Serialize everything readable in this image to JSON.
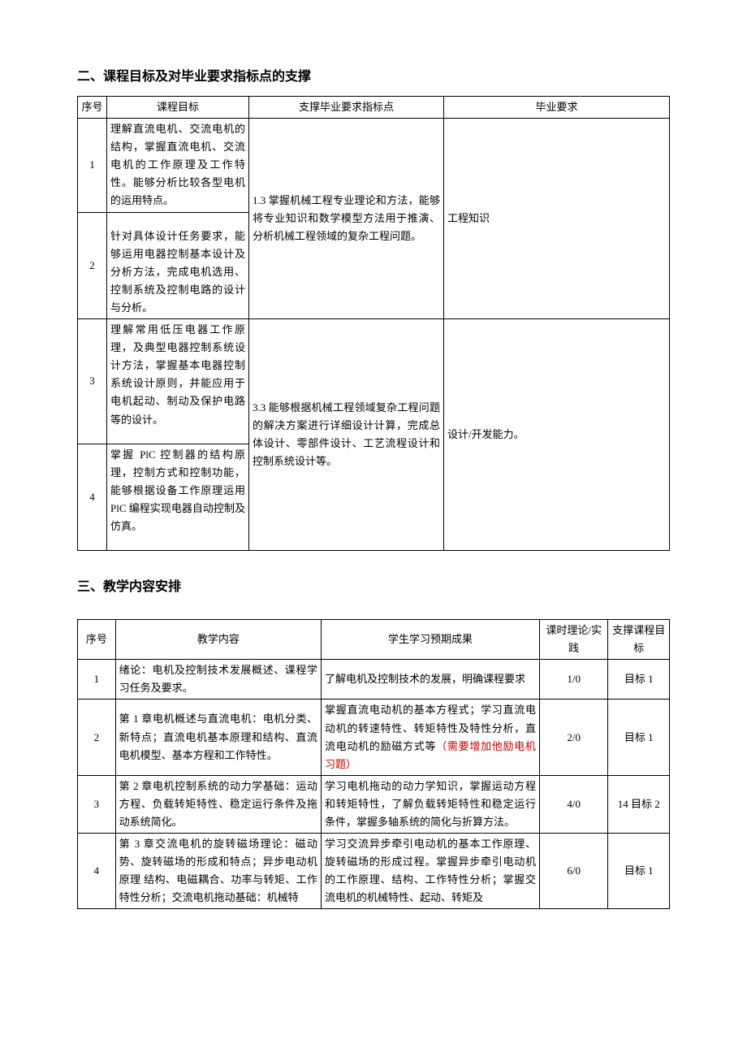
{
  "section2": {
    "title": "二、课程目标及对毕业要求指标点的支撑",
    "headers": [
      "序号",
      "课程目标",
      "支撑毕业要求指标点",
      "毕业要求"
    ],
    "rows": [
      {
        "num": "1",
        "goal": "理解直流电机、交流电机的结构，掌握直流电机、交流电机的工作原理及工作特性。能够分析比较各型电机的运用特点。"
      },
      {
        "num": "2",
        "goal": "针对具体设计任务要求，能够运用电器控制基本设计及分析方法，完成电机选用、控制系统及控制电路的设计与分析。"
      },
      {
        "num": "3",
        "goal": "理解常用低压电器工作原理，及典型电器控制系统设计方法，掌握基本电器控制系统设计原则，并能应用于电机起动、制动及保护电路等的设计。"
      },
      {
        "num": "4",
        "goal": "掌握 PlC 控制器的结构原理，控制方式和控制功能，能够根据设备工作原理运用 PlC 编程实现电器自动控制及仿真。"
      }
    ],
    "indicator1": "1.3 掌握机械工程专业理论和方法，能够将专业知识和数学模型方法用于推演、分析机械工程领域的复杂工程问题。",
    "req1": "工程知识",
    "indicator2": "3.3 能够根据机械工程领域复杂工程问题的解决方案进行详细设计计算，完成总体设计、零部件设计、工艺流程设计和控制系统设计等。",
    "req2": "设计/开发能力。"
  },
  "section3": {
    "title": "三、教学内容安排",
    "headers": [
      "序号",
      "教学内容",
      "学生学习预期成果",
      "课时理论/实践",
      "支撑课程目标"
    ],
    "rows": [
      {
        "num": "1",
        "content": "绪论：电机及控制技术发展概述、课程学习任务及要求。",
        "outcome": "了解电机及控制技术的发展，明确课程要求",
        "hours": "1/0",
        "support": "目标 1"
      },
      {
        "num": "2",
        "content": "第 1 章电机概述与直流电机：电机分类、新特点；直流电机基本原理和结构、直流电机模型、基本方程和工作特性。",
        "outcome_prefix": "掌握直流电动机的基本方程式；学习直流电动机的转速特性、转矩特性及特性分析，直流电动机的励磁方式等",
        "outcome_note": "（需要增加他励电机习题）",
        "hours": "2/0",
        "support": "目标 1"
      },
      {
        "num": "3",
        "content": "第 2 章电机控制系统的动力学基础：运动方程、负载转矩特性、稳定运行条件及拖动系统简化。",
        "outcome": "学习电机拖动的动力学知识，掌握运动方程和转矩特性，了解负载转矩特性和稳定运行条件，掌握多轴系统的简化与折算方法。",
        "hours": "4/0",
        "support": "14 目标 2"
      },
      {
        "num": "4",
        "content": "第 3 章交流电机的旋转磁场理论：磁动势、旋转磁场的形成和特点；异步电动机原理  结构、电磁耦合、功率与转矩、工作特性分析；交流电机拖动基础：机械特",
        "outcome": "学习交流异步牵引电动机的基本工作原理、旋转磁场的形成过程。掌握异步牵引电动机的工作原理、结构、工作特性分析；掌握交流电机的机械特性、起动、转矩及",
        "hours": "6/0",
        "support": "目标 1"
      }
    ]
  }
}
